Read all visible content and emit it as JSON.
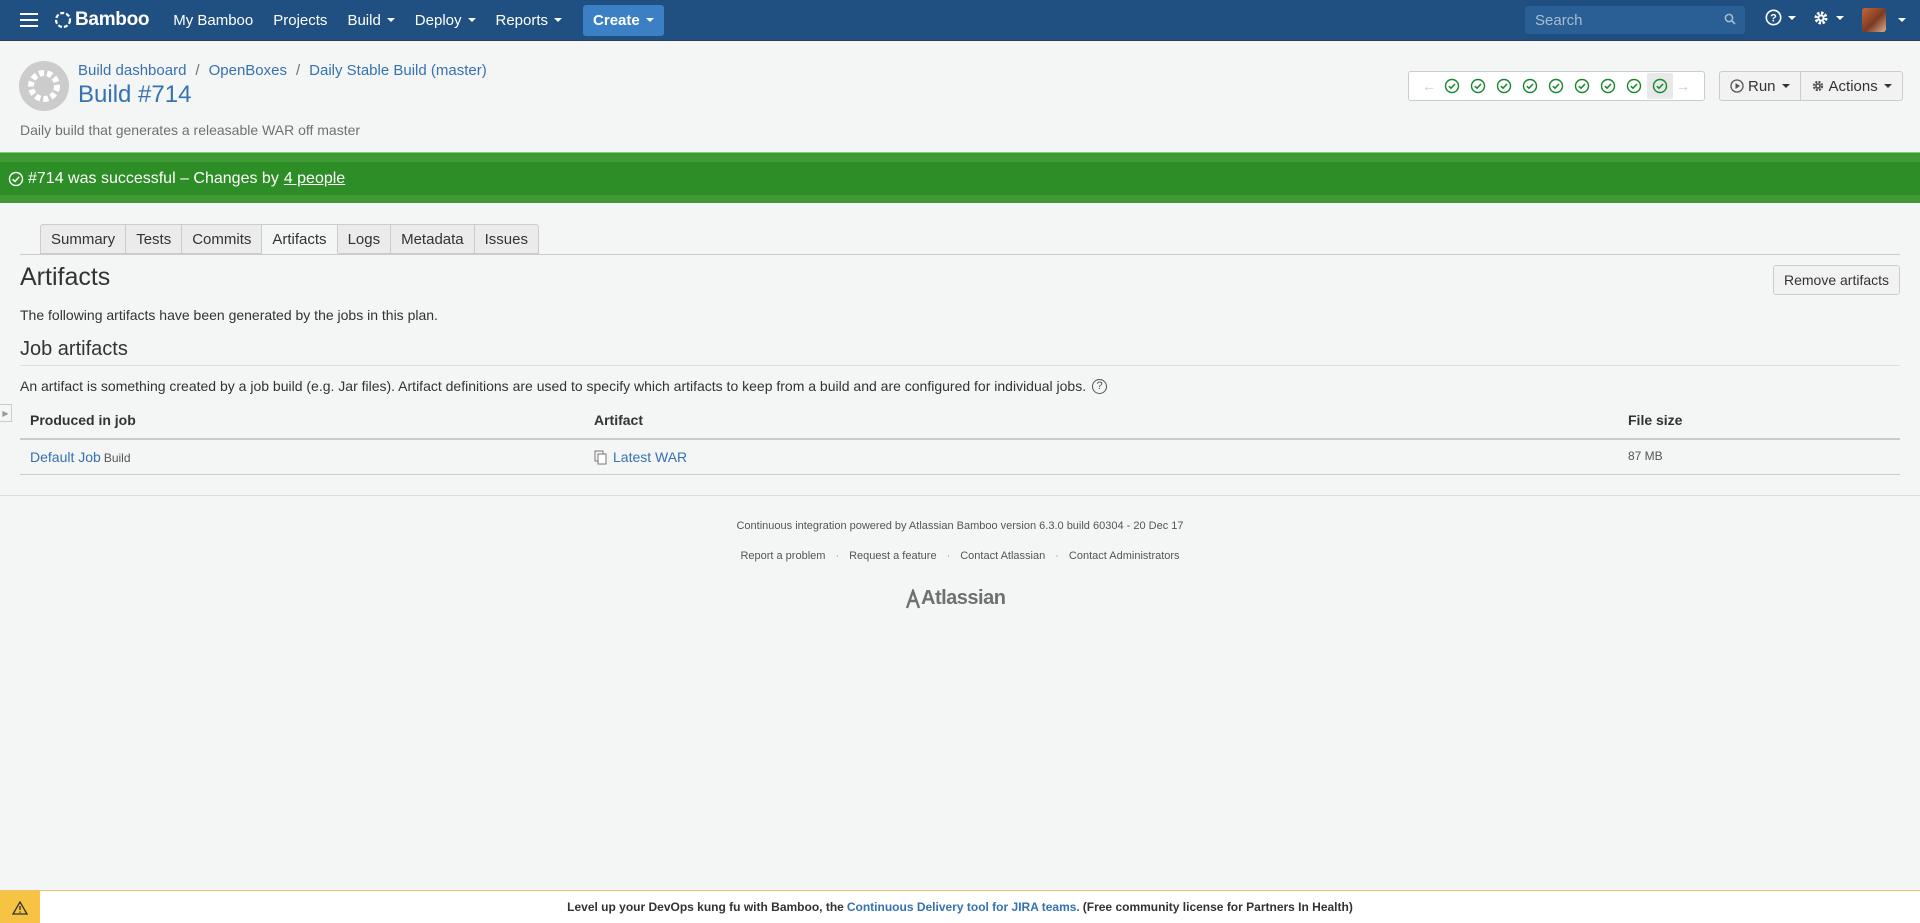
{
  "header": {
    "logo": "Bamboo",
    "nav": [
      {
        "label": "My Bamboo",
        "dropdown": false
      },
      {
        "label": "Projects",
        "dropdown": false
      },
      {
        "label": "Build",
        "dropdown": true
      },
      {
        "label": "Deploy",
        "dropdown": true
      },
      {
        "label": "Reports",
        "dropdown": true
      }
    ],
    "create_label": "Create",
    "search_placeholder": "Search",
    "icons": [
      "help-icon",
      "gear-icon",
      "user-avatar"
    ]
  },
  "page": {
    "breadcrumbs": [
      "Build dashboard",
      "OpenBoxes",
      "Daily Stable Build (master)"
    ],
    "title": "Build #714",
    "description": "Daily build that generates a releasable WAR off master",
    "history": {
      "count": 9,
      "status": "successful"
    },
    "run_label": "Run",
    "actions_label": "Actions"
  },
  "status": {
    "text": "#714 was successful – Changes by",
    "link": "4 people",
    "color": "#2d8d27"
  },
  "tabs": [
    "Summary",
    "Tests",
    "Commits",
    "Artifacts",
    "Logs",
    "Metadata",
    "Issues"
  ],
  "active_tab": "Artifacts",
  "content": {
    "heading": "Artifacts",
    "remove_label": "Remove artifacts",
    "intro": "The following artifacts have been generated by the jobs in this plan.",
    "job_heading": "Job artifacts",
    "job_desc": "An artifact is something created by a job build (e.g. Jar files). Artifact definitions are used to specify which artifacts to keep from a build and are configured for individual jobs.",
    "table": {
      "headers": [
        "Produced in job",
        "Artifact",
        "File size"
      ],
      "rows": [
        {
          "job": "Default Job",
          "stage": "Build",
          "artifact": "Latest WAR",
          "size": "87 MB"
        }
      ]
    }
  },
  "footer": {
    "powered": "Continuous integration powered by Atlassian Bamboo version 6.3.0 build 60304 - 20 Dec 17",
    "links": [
      "Report a problem",
      "Request a feature",
      "Contact Atlassian",
      "Contact Administrators"
    ],
    "brand": "Atlassian"
  },
  "banner": {
    "prefix": "Level up your DevOps kung fu with Bamboo, the",
    "link": "Continuous Delivery tool for JIRA teams.",
    "suffix": "(Free community license for Partners In Health)"
  },
  "colors": {
    "header_bg": "#205081",
    "link": "#3572b0",
    "success": "#2d8d27"
  }
}
